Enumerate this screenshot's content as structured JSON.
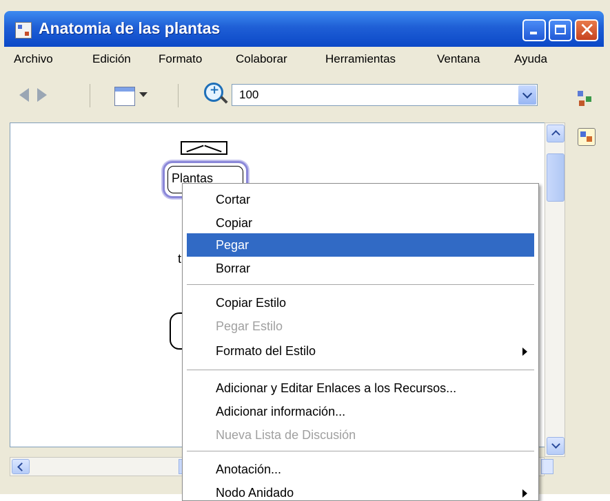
{
  "window": {
    "title": "Anatomia de las plantas",
    "close_glyph": "✕"
  },
  "menubar": {
    "items": [
      "Archivo",
      "Edición",
      "Formato",
      "Colaborar",
      "Herramientas",
      "Ventana",
      "Ayuda"
    ]
  },
  "toolbar": {
    "zoom_value": "100",
    "icons": [
      "back-arrow-icon",
      "forward-arrow-icon",
      "view-mode-icon",
      "zoom-icon",
      "right-panel-icon"
    ]
  },
  "canvas": {
    "concept_label": "Plantas",
    "stub_text": "t"
  },
  "context_menu": {
    "items": [
      {
        "label": "Cortar",
        "state": "normal"
      },
      {
        "label": "Copiar",
        "state": "normal"
      },
      {
        "label": "Pegar",
        "state": "highlighted"
      },
      {
        "label": "Borrar",
        "state": "normal"
      },
      {
        "label": "Copiar Estilo",
        "state": "normal"
      },
      {
        "label": "Pegar Estilo",
        "state": "disabled"
      },
      {
        "label": "Formato del Estilo",
        "state": "submenu"
      },
      {
        "label": "Adicionar y Editar Enlaces a los Recursos...",
        "state": "normal"
      },
      {
        "label": "Adicionar información...",
        "state": "normal"
      },
      {
        "label": "Nueva Lista de Discusión",
        "state": "disabled"
      },
      {
        "label": "Anotación...",
        "state": "normal"
      },
      {
        "label": "Nodo Anidado",
        "state": "submenu"
      }
    ]
  },
  "colors": {
    "title_bar": "#0b48c7",
    "highlight": "#316ac5",
    "concept_border": "#8a87d8"
  }
}
